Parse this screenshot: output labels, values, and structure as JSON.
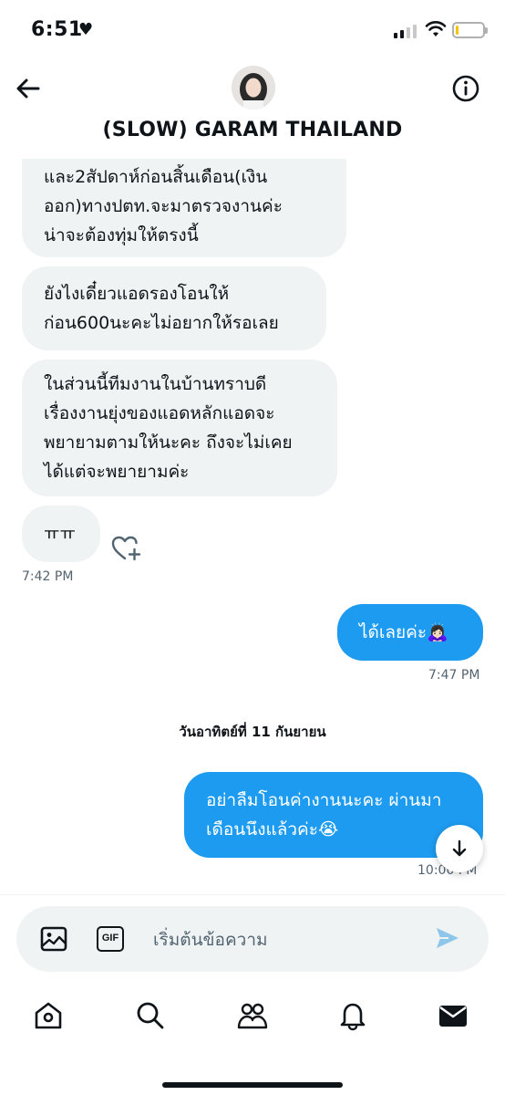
{
  "status_bar": {
    "time": "6:51",
    "status_icon": "heart-icon",
    "signal_icon": "signal-bars-icon",
    "wifi_icon": "wifi-icon",
    "battery_icon": "battery-icon",
    "battery_level": 0.1,
    "battery_color": "#f5c400"
  },
  "header": {
    "title": "(SLOW) GARAM THAILAND",
    "back_icon": "arrow-left-icon",
    "info_icon": "info-icon"
  },
  "messages": [
    {
      "direction": "in",
      "lines": [
        "และ2สัปดาห์ก่อนสิ้นเดือน(เงิน",
        "ออก)ทางปตท.จะมาตรวจงานค่ะ",
        "น่าจะต้องทุ่มให้ตรงนี้"
      ]
    },
    {
      "direction": "in",
      "lines": [
        "ยังไงเดี๋ยวแอดรองโอนให้",
        "ก่อน600นะคะไม่อยากให้รอเลย"
      ]
    },
    {
      "direction": "in",
      "lines": [
        "ในส่วนนี้ทีมงานในบ้านทราบดี",
        "เรื่องงานยุ่งของแอดหลักแอดจะ",
        "พยายามตามให้นะคะ ถึงจะไม่เคย",
        "ได้แต่จะพยายามค่ะ"
      ]
    },
    {
      "direction": "in",
      "lines": [
        "ㅠㅠ"
      ],
      "timestamp": "7:42 PM"
    },
    {
      "direction": "out",
      "lines": [
        "ได้เลยค่ะ🙇🏻‍♀️"
      ],
      "timestamp": "7:47 PM"
    },
    {
      "direction": "out",
      "lines": [
        "อย่าลืมโอนค่างานนะคะ ผ่านมา",
        "เดือนนึงแล้วค่ะ😭"
      ],
      "timestamp": "10:00 PM"
    }
  ],
  "date_separator": "วันอาทิตย์ที่ 11 กันยายน",
  "react_icon": "heart-plus-icon",
  "scroll_down_icon": "arrow-down-icon",
  "composer": {
    "placeholder": "เริ่มต้นข้อความ",
    "image_icon": "image-icon",
    "gif_label": "GIF",
    "send_icon": "send-icon"
  },
  "bottom_nav": {
    "items": [
      "home-icon",
      "search-icon",
      "communities-icon",
      "bell-icon",
      "mail-icon"
    ],
    "active": "mail-icon"
  },
  "colors": {
    "accent": "#1d9bf0",
    "incoming_bubble": "#eff3f4",
    "text_primary": "#0f1419",
    "text_secondary": "#536471"
  }
}
